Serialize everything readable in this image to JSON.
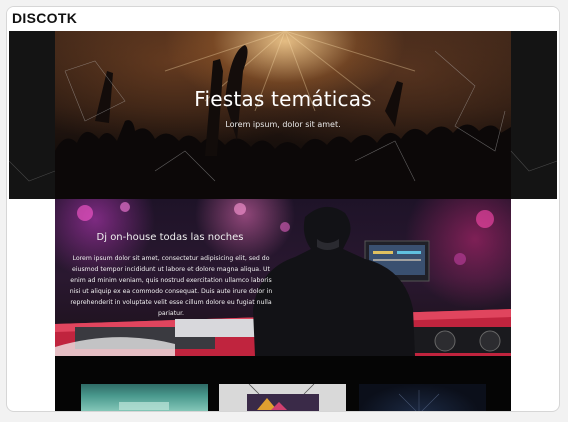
{
  "header": {
    "brand": "DISCOTK"
  },
  "hero": {
    "title": "Fiestas temáticas",
    "subtitle": "Lorem ipsum, dolor sit amet."
  },
  "dj": {
    "title": "Dj on-house todas las noches",
    "text": "Lorem ipsum dolor sit amet, consectetur adipisicing elit, sed do eiusmod tempor incididunt ut labore et dolore magna aliqua. Ut enim ad minim veniam, quis nostrud exercitation ullamco laboris nisi ut aliquip ex ea commodo consequat. Duis aute irure dolor in reprehenderit in voluptate velit esse cillum dolore eu fugiat nulla pariatur."
  },
  "theme": {
    "background": "#ffffff",
    "band": "#141414",
    "accent": "#d9365a"
  }
}
